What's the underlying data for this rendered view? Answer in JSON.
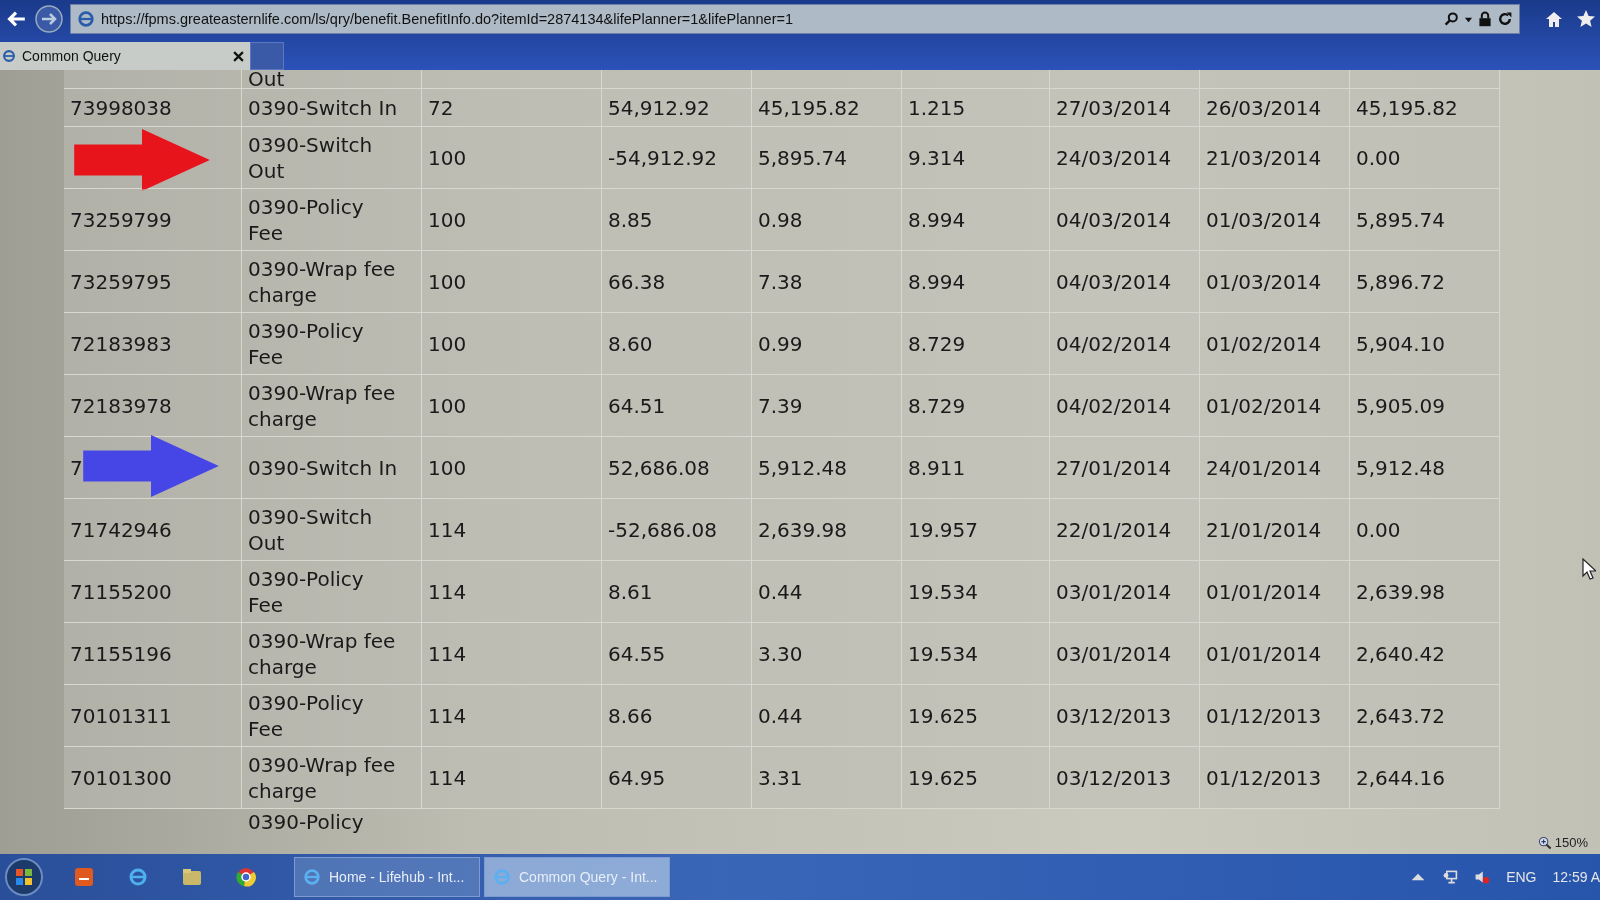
{
  "address_bar": {
    "url": "https://fpms.greateasternlife.com/ls/qry/benefit.BenefitInfo.do?itemId=2874134&lifePlanner=1&lifePlanner=1"
  },
  "tabs": [
    {
      "label": "Common Query",
      "selected": true
    }
  ],
  "table": {
    "top_fragment": "Out",
    "rows": [
      {
        "column_1": "73998038",
        "column_2": "0390-Switch In",
        "column_3": "72",
        "column_4": "54,912.92",
        "column_5": "45,195.82",
        "column_6": "1.215",
        "column_7": "27/03/2014",
        "column_8": "26/03/2014",
        "column_9": "45,195.82"
      },
      {
        "marker": {
          "kind": "arrow",
          "color": "#e8141b"
        },
        "column_2": "0390-Switch Out",
        "column_3": "100",
        "column_4": "-54,912.92",
        "column_5": "5,895.74",
        "column_6": "9.314",
        "column_7": "24/03/2014",
        "column_8": "21/03/2014",
        "column_9": "0.00"
      },
      {
        "column_1": "73259799",
        "column_2": "0390-Policy Fee",
        "column_3": "100",
        "column_4": "8.85",
        "column_5": "0.98",
        "column_6": "8.994",
        "column_7": "04/03/2014",
        "column_8": "01/03/2014",
        "column_9": "5,895.74"
      },
      {
        "column_1": "73259795",
        "column_2": "0390-Wrap fee charge",
        "column_3": "100",
        "column_4": "66.38",
        "column_5": "7.38",
        "column_6": "8.994",
        "column_7": "04/03/2014",
        "column_8": "01/03/2014",
        "column_9": "5,896.72"
      },
      {
        "column_1": "72183983",
        "column_2": "0390-Policy Fee",
        "column_3": "100",
        "column_4": "8.60",
        "column_5": "0.99",
        "column_6": "8.729",
        "column_7": "04/02/2014",
        "column_8": "01/02/2014",
        "column_9": "5,904.10"
      },
      {
        "column_1": "72183978",
        "column_2": "0390-Wrap fee charge",
        "column_3": "100",
        "column_4": "64.51",
        "column_5": "7.39",
        "column_6": "8.729",
        "column_7": "04/02/2014",
        "column_8": "01/02/2014",
        "column_9": "5,905.09"
      },
      {
        "marker": {
          "kind": "arrow",
          "color": "#4646e6"
        },
        "column_1": "7",
        "column_2": "0390-Switch In",
        "column_3": "100",
        "column_4": "52,686.08",
        "column_5": "5,912.48",
        "column_6": "8.911",
        "column_7": "27/01/2014",
        "column_8": "24/01/2014",
        "column_9": "5,912.48"
      },
      {
        "column_1": "71742946",
        "column_2": "0390-Switch Out",
        "column_3": "114",
        "column_4": "-52,686.08",
        "column_5": "2,639.98",
        "column_6": "19.957",
        "column_7": "22/01/2014",
        "column_8": "21/01/2014",
        "column_9": "0.00"
      },
      {
        "column_1": "71155200",
        "column_2": "0390-Policy Fee",
        "column_3": "114",
        "column_4": "8.61",
        "column_5": "0.44",
        "column_6": "19.534",
        "column_7": "03/01/2014",
        "column_8": "01/01/2014",
        "column_9": "2,639.98"
      },
      {
        "column_1": "71155196",
        "column_2": "0390-Wrap fee charge",
        "column_3": "114",
        "column_4": "64.55",
        "column_5": "3.30",
        "column_6": "19.534",
        "column_7": "03/01/2014",
        "column_8": "01/01/2014",
        "column_9": "2,640.42"
      },
      {
        "column_1": "70101311",
        "column_2": "0390-Policy Fee",
        "column_3": "114",
        "column_4": "8.66",
        "column_5": "0.44",
        "column_6": "19.625",
        "column_7": "03/12/2013",
        "column_8": "01/12/2013",
        "column_9": "2,643.72"
      },
      {
        "column_1": "70101300",
        "column_2": "0390-Wrap fee charge",
        "column_3": "114",
        "column_4": "64.95",
        "column_5": "3.31",
        "column_6": "19.625",
        "column_7": "03/12/2013",
        "column_8": "01/12/2013",
        "column_9": "2,644.16"
      }
    ],
    "bottom_fragment": "0390-Policy"
  },
  "zoom_level": "150%",
  "taskbar": {
    "tasks": [
      {
        "label": "Home - Lifehub - Int...",
        "selected": false
      },
      {
        "label": "Common Query - Int...",
        "selected": true
      }
    ],
    "language": "ENG",
    "clock": "12:59 A"
  }
}
